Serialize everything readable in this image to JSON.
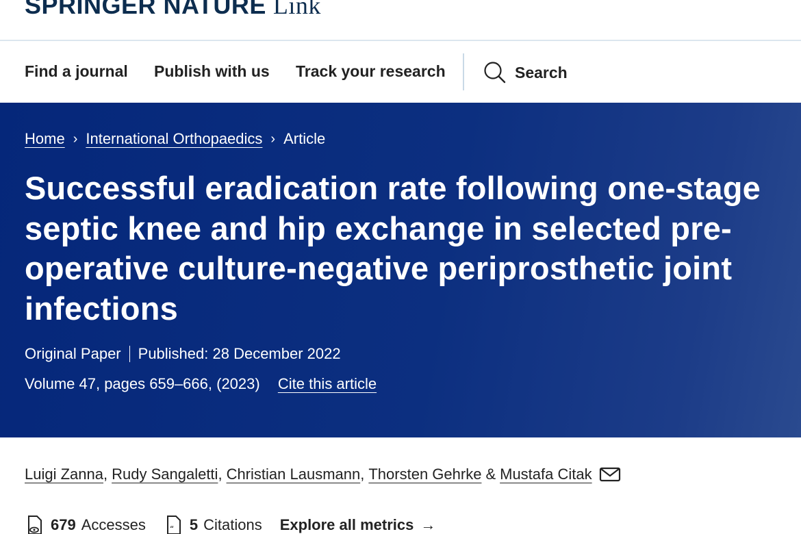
{
  "brand": {
    "springer_nature": "SPRINGER NATURE",
    "link": "Link"
  },
  "nav": {
    "items": [
      {
        "label": "Find a journal"
      },
      {
        "label": "Publish with us"
      },
      {
        "label": "Track your research"
      }
    ],
    "search_label": "Search"
  },
  "breadcrumb": {
    "home": "Home",
    "journal": "International Orthopaedics",
    "current": "Article",
    "separator": "›"
  },
  "article": {
    "title": "Successful eradication rate following one-stage septic knee and hip exchange in selected pre-operative culture-negative periprosthetic joint infections",
    "type": "Original Paper",
    "published": "Published: 28 December 2022",
    "volume": "Volume 47, pages 659–666, (2023)",
    "cite_label": "Cite this article"
  },
  "authors": {
    "list": [
      "Luigi Zanna",
      "Rudy Sangaletti",
      "Christian Lausmann",
      "Thorsten Gehrke",
      "Mustafa Citak"
    ],
    "separator": ",",
    "ampersand": "&"
  },
  "metrics": {
    "accesses_count": "679",
    "accesses_label": "Accesses",
    "citations_count": "5",
    "citations_label": "Citations",
    "explore_label": "Explore all metrics",
    "arrow": "→"
  },
  "colors": {
    "hero_background": "#0c2f80",
    "brand_text": "#0d2d4f",
    "body_text": "#222222",
    "divider": "#dbe6ef"
  }
}
